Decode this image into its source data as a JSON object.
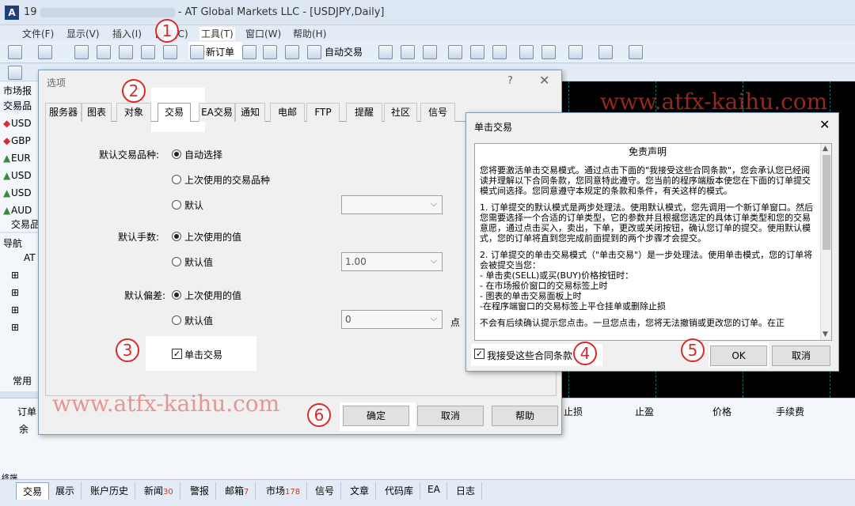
{
  "window": {
    "title_prefix": "19",
    "title": "- AT Global Markets LLC - [USDJPY,Daily]",
    "app_icon": "A"
  },
  "menu": [
    {
      "label": "文件(F)"
    },
    {
      "label": "显示(V)"
    },
    {
      "label": "插入(I)"
    },
    {
      "label": "图表(C)"
    },
    {
      "label": "工具(T)"
    },
    {
      "label": "窗口(W)"
    },
    {
      "label": "帮助(H)"
    }
  ],
  "toolbar": {
    "new_order": "新订单",
    "auto_trading": "自动交易"
  },
  "market_watch": {
    "title": "市场报价",
    "tab": "交易品",
    "symbols": [
      {
        "name": "USD",
        "dir": "dn"
      },
      {
        "name": "GBP",
        "dir": "dn"
      },
      {
        "name": "EUR",
        "dir": "up"
      },
      {
        "name": "USD",
        "dir": "up"
      },
      {
        "name": "USD",
        "dir": "up"
      },
      {
        "name": "AUD",
        "dir": "up"
      }
    ],
    "bottom_tab": "交易品"
  },
  "navigator": {
    "title": "导航",
    "root": "AT",
    "bottom_tab": "常用"
  },
  "terminal": {
    "headers": [
      "订单",
      "止损",
      "止盈",
      "价格",
      "手续费"
    ],
    "balance_label": "余",
    "tabs": [
      {
        "label": "交易",
        "count": ""
      },
      {
        "label": "展示",
        "count": ""
      },
      {
        "label": "账户历史",
        "count": ""
      },
      {
        "label": "新闻",
        "count": "30"
      },
      {
        "label": "警报",
        "count": ""
      },
      {
        "label": "邮箱",
        "count": "7"
      },
      {
        "label": "市场",
        "count": "178"
      },
      {
        "label": "信号",
        "count": ""
      },
      {
        "label": "文章",
        "count": ""
      },
      {
        "label": "代码库",
        "count": ""
      },
      {
        "label": "EA",
        "count": ""
      },
      {
        "label": "日志",
        "count": ""
      }
    ],
    "side_label": "终端"
  },
  "options_dialog": {
    "title": "选项",
    "help": "?",
    "close": "✕",
    "tabs": [
      "服务器",
      "图表",
      "对象",
      "交易",
      "EA交易",
      "通知",
      "电邮",
      "FTP",
      "提醒",
      "社区",
      "信号"
    ],
    "active_tab": "交易",
    "default_symbol_label": "默认交易品种:",
    "symbol_options": [
      "自动选择",
      "上次使用的交易品种",
      "默认"
    ],
    "default_lots_label": "默认手数:",
    "lots_options": [
      "上次使用的值",
      "默认值"
    ],
    "lots_value": "1.00",
    "default_deviation_label": "默认偏差:",
    "deviation_options": [
      "上次使用的值",
      "默认值"
    ],
    "deviation_value": "0",
    "deviation_unit": "点",
    "one_click_label": "单击交易",
    "buttons": {
      "ok": "确定",
      "cancel": "取消",
      "help": "帮助"
    }
  },
  "oneclick_dialog": {
    "title": "单击交易",
    "close": "✕",
    "heading": "免责声明",
    "paragraphs": [
      "您将要激活单击交易模式。通过点击下面的\"我接受这些合同条款\"，您会承认您已经阅读并理解以下合同条款，您同意特此遵守。您当前的程序端版本使您在下面的订单提交模式间选择。您同意遵守本规定的条款和条件，有关这样的模式。",
      "1. 订单提交的默认模式是两步处理法。使用默认模式，您先调用一个新订单窗口。然后您需要选择一个合适的订单类型，它的参数并且根据您选定的具体订单类型和您的交易意愿，通过点击买入，卖出，下单，更改或关闭按钮，确认您订单的提交。使用默认模式，您的订单将直到您完成前面提到的两个步骤才会提交。",
      "2. 订单提交的单击交易模式（\"单击交易\"）是一步处理法。使用单击模式，您的订单将会被提交当您：\n- 单击卖(SELL)或买(BUY)价格按钮时：\n   - 在市场报价窗口的交易标签上时\n   - 图表的单击交易面板上时\n-在程序端窗口的交易标签上平仓挂单或删除止损",
      "不会有后续确认提示您点击。一旦您点击，您将无法撤销或更改您的订单。在正"
    ],
    "accept_label": "我接受这些合同条款",
    "ok": "OK",
    "cancel": "取消"
  },
  "markers": [
    "1",
    "2",
    "3",
    "4",
    "5",
    "6"
  ],
  "watermarks": {
    "top": "www.atfx-kaihu.com",
    "bottom": "www.atfx-kaihu.com"
  },
  "colors": {
    "accent": "#d92b2b",
    "watermark": "#c0392b",
    "chart_bg": "#000000"
  }
}
